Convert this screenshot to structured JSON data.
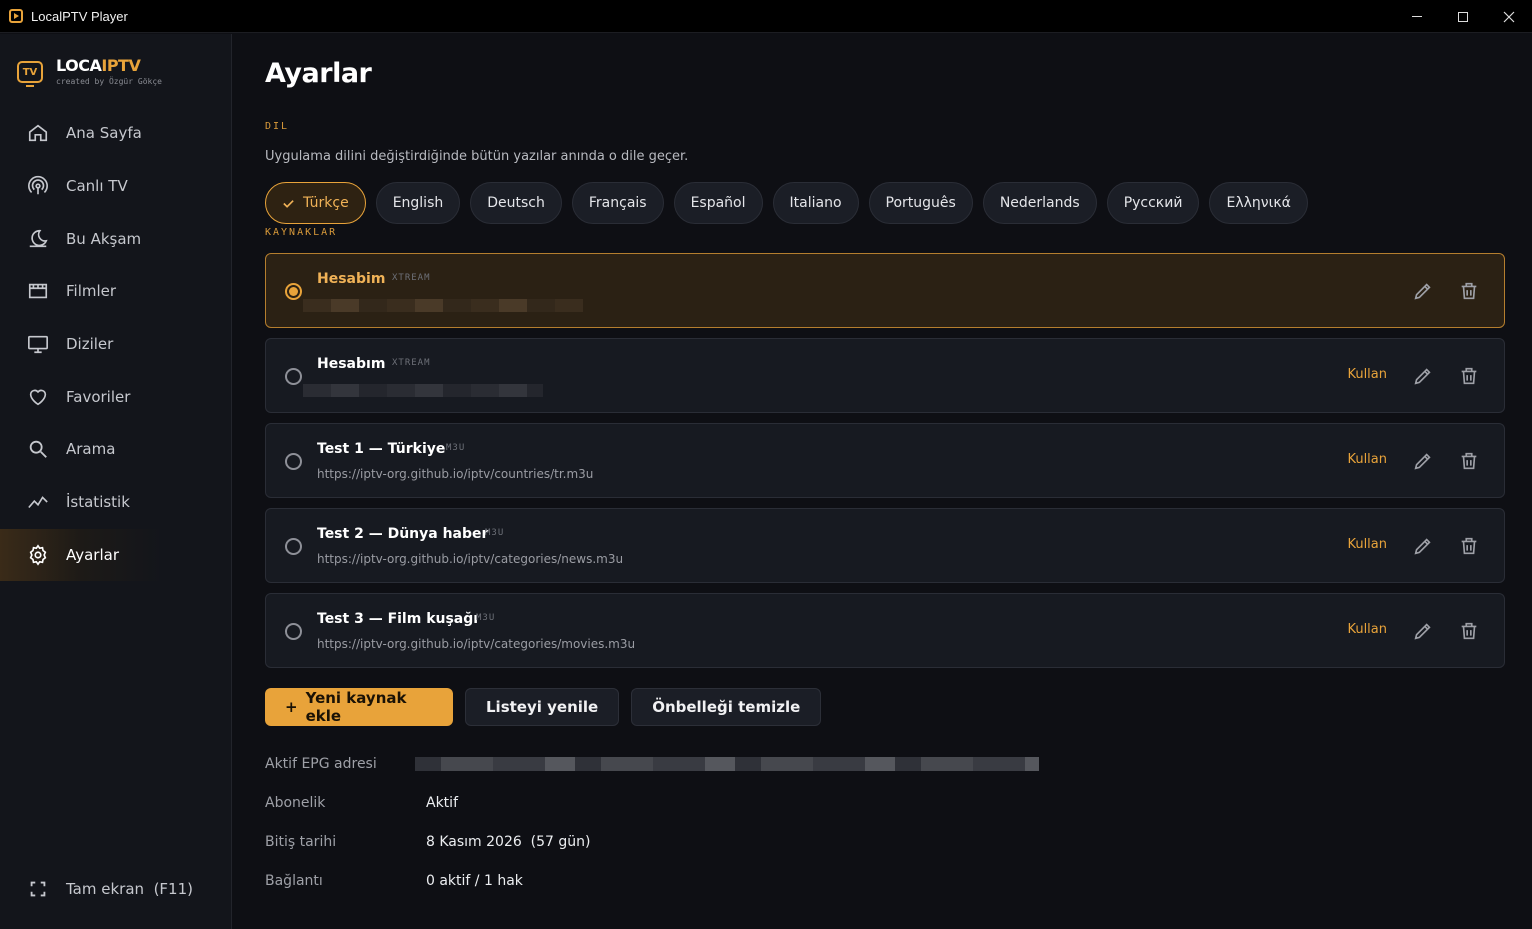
{
  "window": {
    "title": "LocalPTV Player"
  },
  "brand": {
    "name_part1": "LOCA",
    "name_part2": "IPTV",
    "subtitle": "created by Özgür Gökçe",
    "icon_text": "TV"
  },
  "nav": {
    "items": [
      {
        "label": "Ana Sayfa",
        "icon": "home-icon"
      },
      {
        "label": "Canlı TV",
        "icon": "broadcast-icon"
      },
      {
        "label": "Bu Akşam",
        "icon": "moon-icon"
      },
      {
        "label": "Filmler",
        "icon": "film-icon"
      },
      {
        "label": "Diziler",
        "icon": "monitor-icon"
      },
      {
        "label": "Favoriler",
        "icon": "heart-icon"
      },
      {
        "label": "Arama",
        "icon": "search-icon"
      },
      {
        "label": "İstatistik",
        "icon": "chart-icon"
      },
      {
        "label": "Ayarlar",
        "icon": "gear-icon",
        "active": true
      }
    ],
    "fullscreen": "Tam ekran  (F11)"
  },
  "page": {
    "title": "Ayarlar",
    "language_section": "DIL",
    "language_description": "Uygulama dilini değiştirdiğinde bütün yazılar anında o dile geçer.",
    "languages": [
      "Türkçe",
      "English",
      "Deutsch",
      "Français",
      "Español",
      "Italiano",
      "Português",
      "Nederlands",
      "Русский",
      "Ελληνικά"
    ],
    "active_language": "Türkçe",
    "sources_section": "KAYNAKLAR",
    "sources": [
      {
        "name": "Hesabim",
        "type": "XTREAM",
        "url": "",
        "active": true
      },
      {
        "name": "Hesabım",
        "type": "XTREAM",
        "url": "",
        "active": false,
        "use_label": "Kullan"
      },
      {
        "name": "Test 1 — Türkiye",
        "type": "M3U",
        "url": "https://iptv-org.github.io/iptv/countries/tr.m3u",
        "active": false,
        "use_label": "Kullan"
      },
      {
        "name": "Test 2 — Dünya haber",
        "type": "M3U",
        "url": "https://iptv-org.github.io/iptv/categories/news.m3u",
        "active": false,
        "use_label": "Kullan"
      },
      {
        "name": "Test 3 — Film kuşağı",
        "type": "M3U",
        "url": "https://iptv-org.github.io/iptv/categories/movies.m3u",
        "active": false,
        "use_label": "Kullan"
      }
    ],
    "buttons": {
      "add": "Yeni kaynak ekle",
      "add_prefix": "+",
      "refresh": "Listeyi yenile",
      "clear_cache": "Önbelleği temizle"
    },
    "info": {
      "epg_label": "Aktif EPG adresi",
      "subscription_label": "Abonelik",
      "subscription_value": "Aktif",
      "expiry_label": "Bitiş tarihi",
      "expiry_value": "8 Kasım 2026  (57 gün)",
      "connection_label": "Bağlantı",
      "connection_value": "0 aktif / 1 hak"
    }
  },
  "colors": {
    "accent": "#e8a33a",
    "background": "#0e0f14",
    "sidebar": "#13151b"
  }
}
